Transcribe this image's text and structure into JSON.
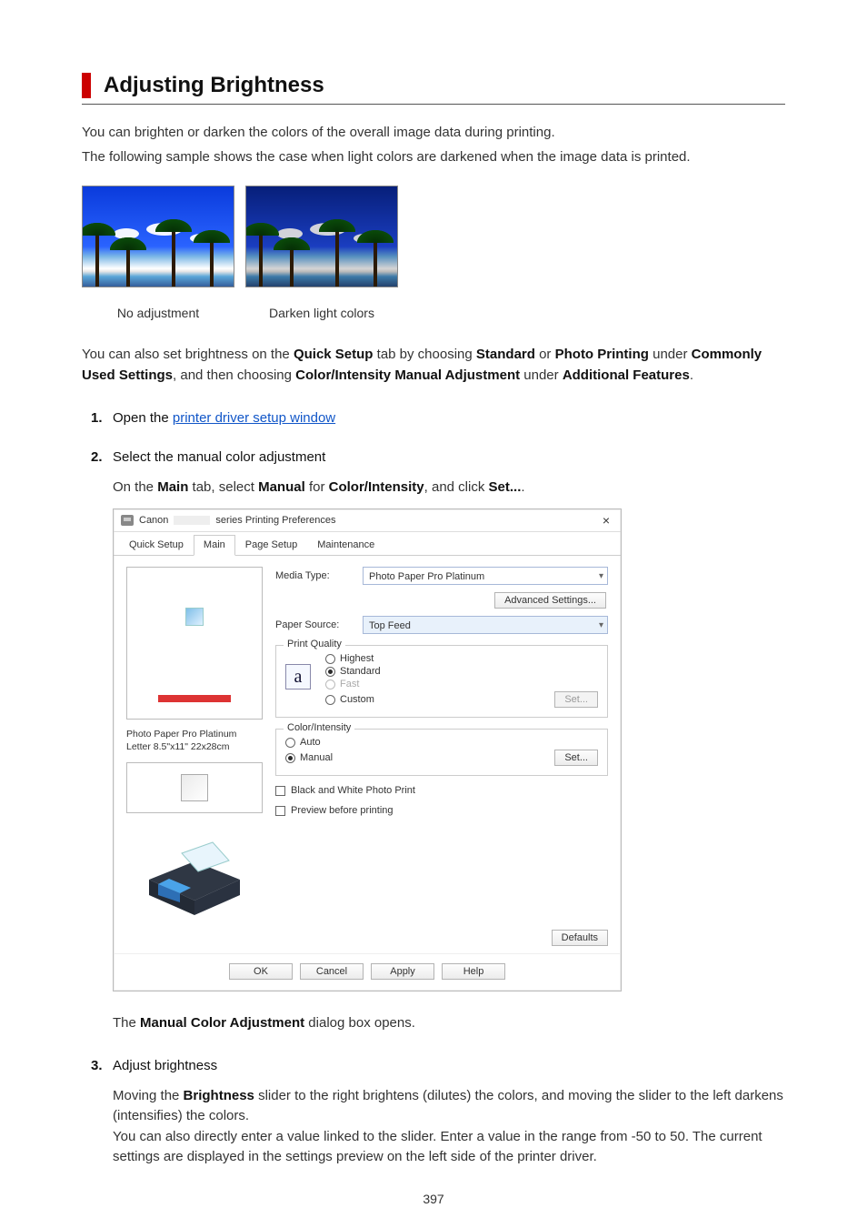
{
  "title": "Adjusting Brightness",
  "intro": [
    "You can brighten or darken the colors of the overall image data during printing.",
    "The following sample shows the case when light colors are darkened when the image data is printed."
  ],
  "captions": {
    "no_adjustment": "No adjustment",
    "darken": "Darken light colors"
  },
  "para1_parts": {
    "p1": "You can also set brightness on the ",
    "b1": "Quick Setup",
    "p2": " tab by choosing ",
    "b2": "Standard",
    "p3": " or ",
    "b3": "Photo Printing",
    "p4": " under ",
    "b4": "Commonly Used Settings",
    "p5": ", and then choosing ",
    "b5": "Color/Intensity Manual Adjustment",
    "p6": " under ",
    "b6": "Additional Features",
    "p7": "."
  },
  "steps": {
    "s1": {
      "num": "1.",
      "lead": "Open the ",
      "link": "printer driver setup window"
    },
    "s2": {
      "num": "2.",
      "head": "Select the manual color adjustment",
      "sub_parts": {
        "a": "On the ",
        "b": "Main",
        "c": " tab, select ",
        "d": "Manual",
        "e": " for ",
        "f": "Color/Intensity",
        "g": ", and click ",
        "h": "Set...",
        "i": "."
      },
      "after_parts": {
        "a": "The ",
        "b": "Manual Color Adjustment",
        "c": " dialog box opens."
      }
    },
    "s3": {
      "num": "3.",
      "head": "Adjust brightness",
      "p_parts": {
        "a": "Moving the ",
        "b": "Brightness",
        "c": " slider to the right brightens (dilutes) the colors, and moving the slider to the left darkens (intensifies) the colors.",
        "d": "You can also directly enter a value linked to the slider. Enter a value in the range from -50 to 50. The current settings are displayed in the settings preview on the left side of the printer driver."
      }
    }
  },
  "dialog": {
    "title_prefix": "Canon",
    "title_suffix": "series Printing Preferences",
    "tabs": [
      "Quick Setup",
      "Main",
      "Page Setup",
      "Maintenance"
    ],
    "labels": {
      "media_type": "Media Type:",
      "paper_source": "Paper Source:",
      "print_quality": "Print Quality",
      "color_intensity": "Color/Intensity"
    },
    "values": {
      "media_type": "Photo Paper Pro Platinum",
      "paper_source": "Top Feed",
      "paper_label_1": "Photo Paper Pro Platinum",
      "paper_label_2": "Letter 8.5\"x11\" 22x28cm",
      "a_mark": "a"
    },
    "quality": {
      "highest": "Highest",
      "standard": "Standard",
      "fast": "Fast",
      "custom": "Custom"
    },
    "ci": {
      "auto": "Auto",
      "manual": "Manual"
    },
    "checks": {
      "bw": "Black and White Photo Print",
      "preview": "Preview before printing"
    },
    "buttons": {
      "advanced": "Advanced Settings...",
      "set_disabled": "Set...",
      "set": "Set...",
      "defaults": "Defaults",
      "ok": "OK",
      "cancel": "Cancel",
      "apply": "Apply",
      "help": "Help"
    }
  },
  "pagenum": "397"
}
